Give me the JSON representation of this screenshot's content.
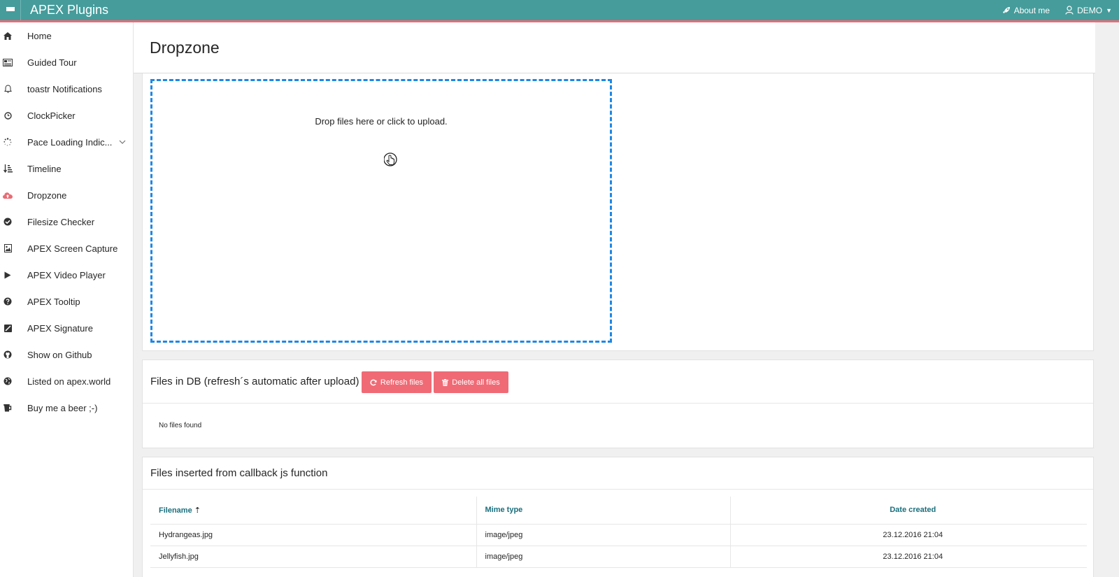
{
  "header": {
    "app_title": "APEX Plugins",
    "about_label": "About me",
    "user_label": "DEMO",
    "accent_color": "#459c9b",
    "highlight_color": "#e96c75"
  },
  "sidebar": {
    "items": [
      {
        "label": "Home",
        "icon": "home-icon"
      },
      {
        "label": "Guided Tour",
        "icon": "newspaper-icon"
      },
      {
        "label": "toastr Notifications",
        "icon": "bell-icon"
      },
      {
        "label": "ClockPicker",
        "icon": "clock-icon"
      },
      {
        "label": "Pace Loading Indic...",
        "icon": "spinner-icon"
      },
      {
        "label": "Timeline",
        "icon": "sort-amount-icon"
      },
      {
        "label": "Dropzone",
        "icon": "cloud-upload-icon"
      },
      {
        "label": "Filesize Checker",
        "icon": "check-circle-icon"
      },
      {
        "label": "APEX Screen Capture",
        "icon": "image-icon"
      },
      {
        "label": "APEX Video Player",
        "icon": "play-icon"
      },
      {
        "label": "APEX Tooltip",
        "icon": "question-circle-icon"
      },
      {
        "label": "APEX Signature",
        "icon": "signature-icon"
      },
      {
        "label": "Show on Github",
        "icon": "github-icon"
      },
      {
        "label": "Listed on apex.world",
        "icon": "globe-icon"
      },
      {
        "label": "Buy me a beer ;-)",
        "icon": "beer-icon"
      }
    ]
  },
  "page": {
    "title": "Dropzone"
  },
  "dropzone": {
    "message": "Drop files here or click to upload.",
    "border_color": "#1e88e5"
  },
  "files_db": {
    "title": "Files in DB (refresh´s automatic after upload)",
    "refresh_label": "Refresh files",
    "delete_label": "Delete all files",
    "empty_message": "No files found",
    "button_color": "#f06a75"
  },
  "callback": {
    "title": "Files inserted from callback js function",
    "columns": [
      "Filename",
      "Mime type",
      "Date created"
    ],
    "rows": [
      [
        "Hydrangeas.jpg",
        "image/jpeg",
        "23.12.2016 21:04"
      ],
      [
        "Jellyfish.jpg",
        "image/jpeg",
        "23.12.2016 21:04"
      ]
    ]
  }
}
